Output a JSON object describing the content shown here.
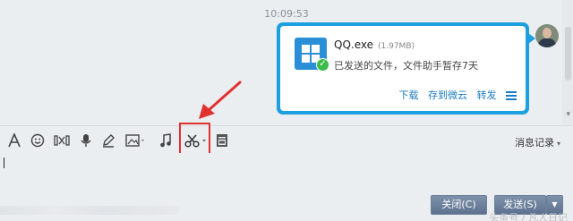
{
  "chat": {
    "timestamp": "10:09:53"
  },
  "file_message": {
    "file_name": "QQ.exe",
    "file_size": "(1.97MB)",
    "status": "已发送的文件，文件助手暂存7天",
    "actions": {
      "download": "下载",
      "save_to_cloud": "存到微云",
      "forward": "转发"
    },
    "bubble_color": "#1ea0e0",
    "icon": "windows-exe-icon",
    "status_icon": "check-icon"
  },
  "toolbar": {
    "icons": [
      "font-icon",
      "emoji-icon",
      "video-clip-icon",
      "microphone-icon",
      "pen-icon",
      "image-icon",
      "music-icon",
      "scissors-icon",
      "shake-icon"
    ],
    "history_label": "消息记录",
    "highlight_color": "#e03131"
  },
  "actions": {
    "close_label": "关闭(C)",
    "send_label": "发送(S)"
  },
  "watermark": "头条号 / 凡人日记"
}
